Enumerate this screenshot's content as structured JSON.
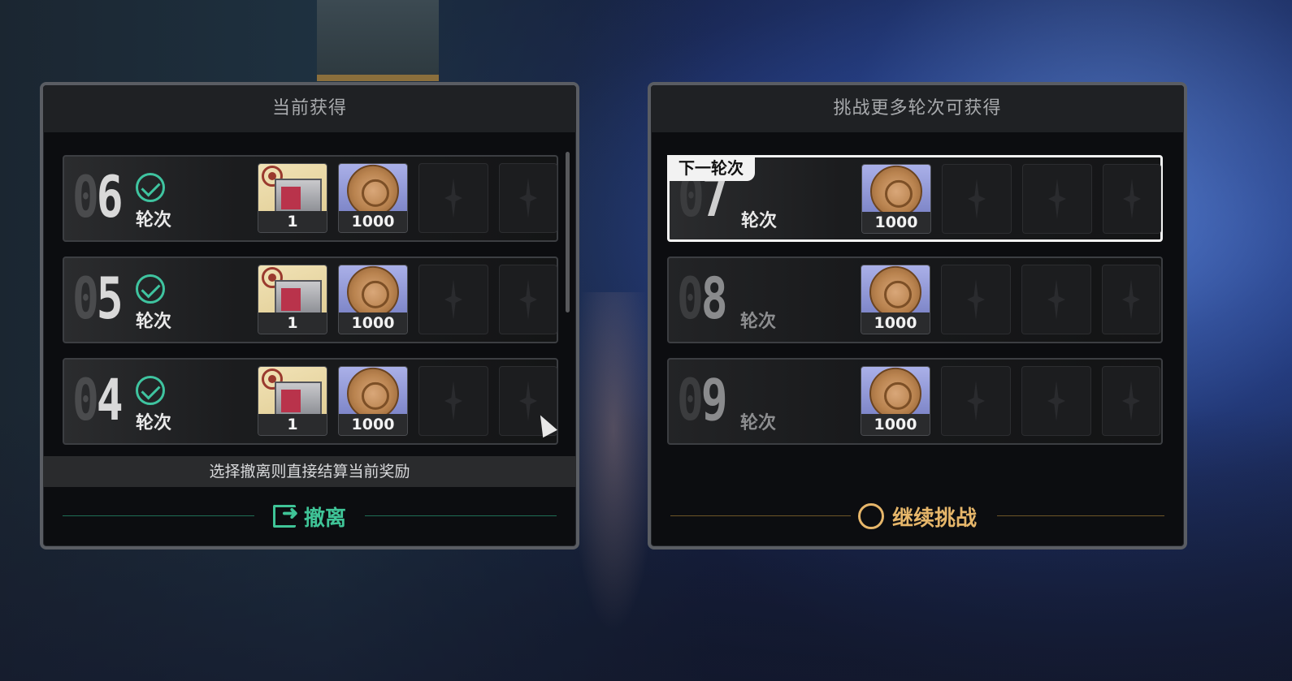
{
  "left_panel": {
    "title": "当前获得",
    "rows": [
      {
        "digits": [
          "0",
          "6"
        ],
        "label": "轮次",
        "rewards": [
          {
            "icon": "supply-box-icon",
            "qty": "1"
          },
          {
            "icon": "coin-icon",
            "qty": "1000"
          }
        ]
      },
      {
        "digits": [
          "0",
          "5"
        ],
        "label": "轮次",
        "rewards": [
          {
            "icon": "supply-box-icon",
            "qty": "1"
          },
          {
            "icon": "coin-icon",
            "qty": "1000"
          }
        ]
      },
      {
        "digits": [
          "0",
          "4"
        ],
        "label": "轮次",
        "rewards": [
          {
            "icon": "supply-box-icon",
            "qty": "1"
          },
          {
            "icon": "coin-icon",
            "qty": "1000"
          }
        ]
      }
    ],
    "notice": "选择撤离则直接结算当前奖励",
    "action_label": "撤离"
  },
  "right_panel": {
    "title": "挑战更多轮次可获得",
    "next_tag": "下一轮次",
    "rows": [
      {
        "digits": [
          "0",
          "7"
        ],
        "label": "轮次",
        "rewards": [
          {
            "icon": "coin-icon",
            "qty": "1000"
          }
        ]
      },
      {
        "digits": [
          "0",
          "8"
        ],
        "label": "轮次",
        "rewards": [
          {
            "icon": "coin-icon",
            "qty": "1000"
          }
        ]
      },
      {
        "digits": [
          "0",
          "9"
        ],
        "label": "轮次",
        "rewards": [
          {
            "icon": "coin-icon",
            "qty": "1000"
          }
        ]
      }
    ],
    "action_label": "继续挑战"
  },
  "colors": {
    "accent_green": "#3fc497",
    "accent_gold": "#e6b66a",
    "panel_bg": "#0c0d10"
  }
}
